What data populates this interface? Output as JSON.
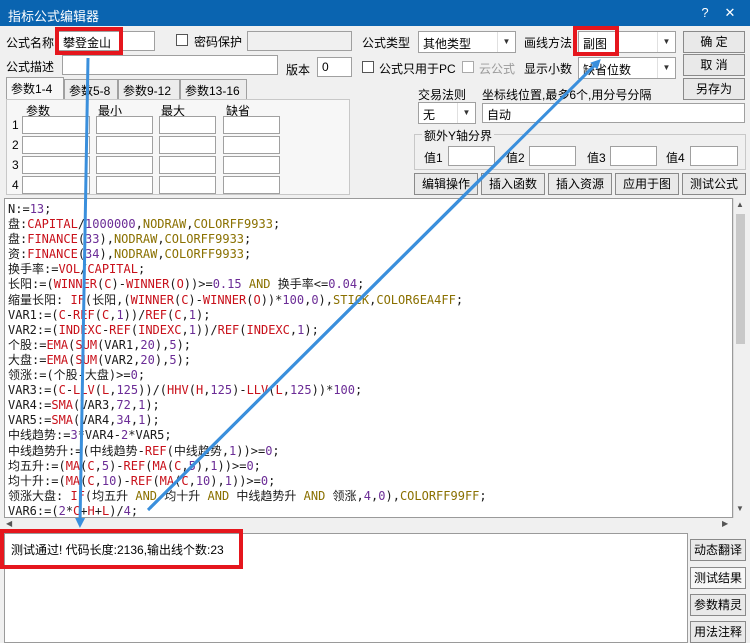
{
  "window": {
    "title": "指标公式编辑器",
    "help_glyph": "?",
    "close_glyph": "✕"
  },
  "header": {
    "name_label": "公式名称",
    "name_value": "攀登金山",
    "password_label": "密码保护",
    "type_label": "公式类型",
    "type_value": "其他类型",
    "draw_label": "画线方法",
    "draw_value": "副图",
    "desc_label": "公式描述",
    "version_label": "版本",
    "version_value": "0",
    "pc_only_label": "公式只用于PC",
    "cloud_label": "云公式",
    "decimals_label": "显示小数",
    "decimals_value": "缺省位数"
  },
  "buttons": {
    "ok": "确  定",
    "cancel": "取  消",
    "save_as": "另存为",
    "edit_ops": "编辑操作",
    "insert_func": "插入函数",
    "insert_res": "插入资源",
    "apply_chart": "应用于图",
    "test": "测试公式"
  },
  "tabs": [
    "参数1-4",
    "参数5-8",
    "参数9-12",
    "参数13-16"
  ],
  "params": {
    "headers": [
      "参数",
      "最小",
      "最大",
      "缺省"
    ],
    "rows": [
      "1",
      "2",
      "3",
      "4"
    ]
  },
  "trade": {
    "label": "交易法则",
    "value": "无",
    "axis_label": "坐标线位置,最多6个,用分号分隔",
    "axis_value": "自动"
  },
  "extra_y": {
    "title": "额外Y轴分界",
    "labels": [
      "值1",
      "值2",
      "值3",
      "值4"
    ]
  },
  "code_lines": [
    [
      [
        "N:=",
        "s"
      ],
      [
        "13",
        "n"
      ],
      [
        ";",
        "s"
      ]
    ],
    [
      [
        "盘:",
        "s"
      ],
      [
        "CAPITAL",
        "f"
      ],
      [
        "/",
        "s"
      ],
      [
        "1000000",
        "n"
      ],
      [
        ",",
        "s"
      ],
      [
        "NODRAW",
        "k"
      ],
      [
        ",",
        "s"
      ],
      [
        "COLORFF9933",
        "k"
      ],
      [
        ";",
        "s"
      ]
    ],
    [
      [
        "盘:",
        "s"
      ],
      [
        "FINANCE",
        "f"
      ],
      [
        "(",
        "s"
      ],
      [
        "33",
        "n"
      ],
      [
        "),",
        "s"
      ],
      [
        "NODRAW",
        "k"
      ],
      [
        ",",
        "s"
      ],
      [
        "COLORFF9933",
        "k"
      ],
      [
        ";",
        "s"
      ]
    ],
    [
      [
        "资:",
        "s"
      ],
      [
        "FINANCE",
        "f"
      ],
      [
        "(",
        "s"
      ],
      [
        "34",
        "n"
      ],
      [
        "),",
        "s"
      ],
      [
        "NODRAW",
        "k"
      ],
      [
        ",",
        "s"
      ],
      [
        "COLORFF9933",
        "k"
      ],
      [
        ";",
        "s"
      ]
    ],
    [
      [
        "换手率:=",
        "s"
      ],
      [
        "VOL",
        "f"
      ],
      [
        "/",
        "s"
      ],
      [
        "CAPITAL",
        "f"
      ],
      [
        ";",
        "s"
      ]
    ],
    [
      [
        "长阳:=(",
        "s"
      ],
      [
        "WINNER",
        "f"
      ],
      [
        "(",
        "s"
      ],
      [
        "C",
        "f"
      ],
      [
        ")-",
        "s"
      ],
      [
        "WINNER",
        "f"
      ],
      [
        "(",
        "s"
      ],
      [
        "O",
        "f"
      ],
      [
        "))>=",
        "s"
      ],
      [
        "0.15",
        "n"
      ],
      [
        " ",
        "s"
      ],
      [
        "AND",
        "k"
      ],
      [
        " 换手率<=",
        "s"
      ],
      [
        "0.04",
        "n"
      ],
      [
        ";",
        "s"
      ]
    ],
    [
      [
        "缩量长阳: ",
        "s"
      ],
      [
        "IF",
        "f"
      ],
      [
        "(长阳,(",
        "s"
      ],
      [
        "WINNER",
        "f"
      ],
      [
        "(",
        "s"
      ],
      [
        "C",
        "f"
      ],
      [
        ")-",
        "s"
      ],
      [
        "WINNER",
        "f"
      ],
      [
        "(",
        "s"
      ],
      [
        "O",
        "f"
      ],
      [
        "))*",
        "s"
      ],
      [
        "100",
        "n"
      ],
      [
        ",",
        "s"
      ],
      [
        "0",
        "n"
      ],
      [
        "),",
        "s"
      ],
      [
        "STICK",
        "k"
      ],
      [
        ",",
        "s"
      ],
      [
        "COLOR6EA4FF",
        "k"
      ],
      [
        ";",
        "s"
      ]
    ],
    [
      [
        "VAR1:=(",
        "s"
      ],
      [
        "C",
        "f"
      ],
      [
        "-",
        "s"
      ],
      [
        "REF",
        "f"
      ],
      [
        "(",
        "s"
      ],
      [
        "C",
        "f"
      ],
      [
        ",",
        "s"
      ],
      [
        "1",
        "n"
      ],
      [
        "))/",
        "s"
      ],
      [
        "REF",
        "f"
      ],
      [
        "(",
        "s"
      ],
      [
        "C",
        "f"
      ],
      [
        ",",
        "s"
      ],
      [
        "1",
        "n"
      ],
      [
        ");",
        "s"
      ]
    ],
    [
      [
        "VAR2:=(",
        "s"
      ],
      [
        "INDEXC",
        "f"
      ],
      [
        "-",
        "s"
      ],
      [
        "REF",
        "f"
      ],
      [
        "(",
        "s"
      ],
      [
        "INDEXC",
        "f"
      ],
      [
        ",",
        "s"
      ],
      [
        "1",
        "n"
      ],
      [
        "))/",
        "s"
      ],
      [
        "REF",
        "f"
      ],
      [
        "(",
        "s"
      ],
      [
        "INDEXC",
        "f"
      ],
      [
        ",",
        "s"
      ],
      [
        "1",
        "n"
      ],
      [
        ");",
        "s"
      ]
    ],
    [
      [
        "个股:=",
        "s"
      ],
      [
        "EMA",
        "f"
      ],
      [
        "(",
        "s"
      ],
      [
        "SUM",
        "f"
      ],
      [
        "(VAR1,",
        "s"
      ],
      [
        "20",
        "n"
      ],
      [
        "),",
        "s"
      ],
      [
        "5",
        "n"
      ],
      [
        ");",
        "s"
      ]
    ],
    [
      [
        "大盘:=",
        "s"
      ],
      [
        "EMA",
        "f"
      ],
      [
        "(",
        "s"
      ],
      [
        "SUM",
        "f"
      ],
      [
        "(VAR2,",
        "s"
      ],
      [
        "20",
        "n"
      ],
      [
        "),",
        "s"
      ],
      [
        "5",
        "n"
      ],
      [
        ");",
        "s"
      ]
    ],
    [
      [
        "领涨:=(个股-大盘)>=",
        "s"
      ],
      [
        "0",
        "n"
      ],
      [
        ";",
        "s"
      ]
    ],
    [
      [
        "VAR3:=(",
        "s"
      ],
      [
        "C",
        "f"
      ],
      [
        "-",
        "s"
      ],
      [
        "LLV",
        "f"
      ],
      [
        "(",
        "s"
      ],
      [
        "L",
        "f"
      ],
      [
        ",",
        "s"
      ],
      [
        "125",
        "n"
      ],
      [
        "))/(",
        "s"
      ],
      [
        "HHV",
        "f"
      ],
      [
        "(",
        "s"
      ],
      [
        "H",
        "f"
      ],
      [
        ",",
        "s"
      ],
      [
        "125",
        "n"
      ],
      [
        ")-",
        "s"
      ],
      [
        "LLV",
        "f"
      ],
      [
        "(",
        "s"
      ],
      [
        "L",
        "f"
      ],
      [
        ",",
        "s"
      ],
      [
        "125",
        "n"
      ],
      [
        "))*",
        "s"
      ],
      [
        "100",
        "n"
      ],
      [
        ";",
        "s"
      ]
    ],
    [
      [
        "VAR4:=",
        "s"
      ],
      [
        "SMA",
        "f"
      ],
      [
        "(VAR3,",
        "s"
      ],
      [
        "72",
        "n"
      ],
      [
        ",",
        "s"
      ],
      [
        "1",
        "n"
      ],
      [
        ");",
        "s"
      ]
    ],
    [
      [
        "VAR5:=",
        "s"
      ],
      [
        "SMA",
        "f"
      ],
      [
        "(VAR4,",
        "s"
      ],
      [
        "34",
        "n"
      ],
      [
        ",",
        "s"
      ],
      [
        "1",
        "n"
      ],
      [
        ");",
        "s"
      ]
    ],
    [
      [
        "中线趋势:=",
        "s"
      ],
      [
        "3",
        "n"
      ],
      [
        "*VAR4-",
        "s"
      ],
      [
        "2",
        "n"
      ],
      [
        "*VAR5;",
        "s"
      ]
    ],
    [
      [
        "中线趋势升:=(中线趋势-",
        "s"
      ],
      [
        "REF",
        "f"
      ],
      [
        "(中线趋势,",
        "s"
      ],
      [
        "1",
        "n"
      ],
      [
        "))>=",
        "s"
      ],
      [
        "0",
        "n"
      ],
      [
        ";",
        "s"
      ]
    ],
    [
      [
        "均五升:=(",
        "s"
      ],
      [
        "MA",
        "f"
      ],
      [
        "(",
        "s"
      ],
      [
        "C",
        "f"
      ],
      [
        ",",
        "s"
      ],
      [
        "5",
        "n"
      ],
      [
        ")-",
        "s"
      ],
      [
        "REF",
        "f"
      ],
      [
        "(",
        "s"
      ],
      [
        "MA",
        "f"
      ],
      [
        "(",
        "s"
      ],
      [
        "C",
        "f"
      ],
      [
        ",",
        "s"
      ],
      [
        "5",
        "n"
      ],
      [
        "),",
        "s"
      ],
      [
        "1",
        "n"
      ],
      [
        "))>=",
        "s"
      ],
      [
        "0",
        "n"
      ],
      [
        ";",
        "s"
      ]
    ],
    [
      [
        "均十升:=(",
        "s"
      ],
      [
        "MA",
        "f"
      ],
      [
        "(",
        "s"
      ],
      [
        "C",
        "f"
      ],
      [
        ",",
        "s"
      ],
      [
        "10",
        "n"
      ],
      [
        ")-",
        "s"
      ],
      [
        "REF",
        "f"
      ],
      [
        "(",
        "s"
      ],
      [
        "MA",
        "f"
      ],
      [
        "(",
        "s"
      ],
      [
        "C",
        "f"
      ],
      [
        ",",
        "s"
      ],
      [
        "10",
        "n"
      ],
      [
        "),",
        "s"
      ],
      [
        "1",
        "n"
      ],
      [
        "))>=",
        "s"
      ],
      [
        "0",
        "n"
      ],
      [
        ";",
        "s"
      ]
    ],
    [
      [
        "领涨大盘: ",
        "s"
      ],
      [
        "IF",
        "f"
      ],
      [
        "(均五升 ",
        "s"
      ],
      [
        "AND",
        "k"
      ],
      [
        " 均十升 ",
        "s"
      ],
      [
        "AND",
        "k"
      ],
      [
        " 中线趋势升 ",
        "s"
      ],
      [
        "AND",
        "k"
      ],
      [
        " 领涨,",
        "s"
      ],
      [
        "4",
        "n"
      ],
      [
        ",",
        "s"
      ],
      [
        "0",
        "n"
      ],
      [
        "),",
        "s"
      ],
      [
        "COLORFF99FF",
        "k"
      ],
      [
        ";",
        "s"
      ]
    ],
    [
      [
        "VAR6:=(",
        "s"
      ],
      [
        "2",
        "n"
      ],
      [
        "*",
        "s"
      ],
      [
        "C",
        "f"
      ],
      [
        "+",
        "s"
      ],
      [
        "H",
        "f"
      ],
      [
        "+",
        "s"
      ],
      [
        "L",
        "f"
      ],
      [
        ")/",
        "s"
      ],
      [
        "4",
        "n"
      ],
      [
        ";",
        "s"
      ]
    ]
  ],
  "output": {
    "message": "测试通过! 代码长度:2136,输出线个数:23"
  },
  "side_buttons": [
    "动态翻译",
    "测试结果",
    "参数精灵",
    "用法注释"
  ],
  "colors": {
    "titlebar": "#0a64b0",
    "highlight": "#e5161d",
    "arrow": "#3a8fdc"
  }
}
